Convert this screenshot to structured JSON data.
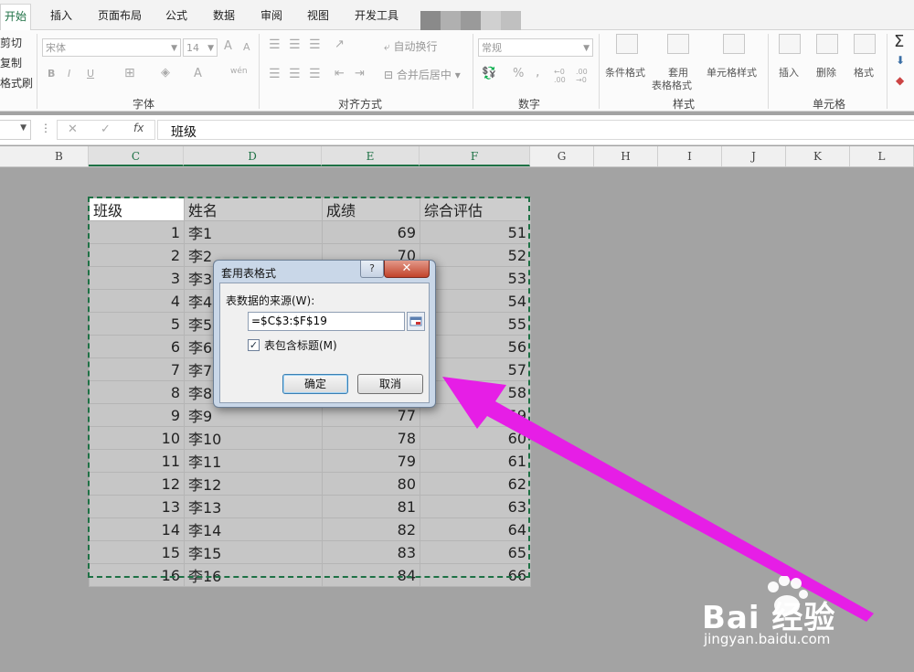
{
  "ribbon": {
    "tabs": [
      "开始",
      "插入",
      "页面布局",
      "公式",
      "数据",
      "审阅",
      "视图",
      "开发工具"
    ],
    "active_tab": "开始",
    "clipboard": {
      "cut": "剪切",
      "copy": "复制",
      "format_painter": "格式刷"
    },
    "font": {
      "name": "宋体",
      "size": "14",
      "bold": "B",
      "italic": "I",
      "underline": "U",
      "grow": "A",
      "shrink": "A",
      "color": "A",
      "phonetic": "wén",
      "group": "字体"
    },
    "alignment": {
      "wrap": "自动换行",
      "merge": "合并后居中",
      "group": "对齐方式"
    },
    "number": {
      "format": "常规",
      "percent": "%",
      "comma": ",",
      "inc_dec": "←0 .00",
      "dec_dec": ".00 →0",
      "group": "数字"
    },
    "styles": {
      "conditional": "条件格式",
      "apply_table": "套用",
      "apply_table_2": "表格格式",
      "cell_styles": "单元格样式",
      "group": "样式"
    },
    "cells": {
      "insert": "插入",
      "delete": "删除",
      "format": "格式",
      "group": "单元格"
    },
    "editing": {
      "sum": "Σ"
    }
  },
  "formula_bar": {
    "fx": "fx",
    "cancel": "✕",
    "enter": "✓",
    "value": "班级"
  },
  "columns": [
    "B",
    "C",
    "D",
    "E",
    "F",
    "G",
    "H",
    "I",
    "J",
    "K",
    "L"
  ],
  "selected_columns": [
    "C",
    "D",
    "E",
    "F"
  ],
  "sheet": {
    "headers": [
      "班级",
      "姓名",
      "成绩",
      "综合评估"
    ],
    "rows": [
      [
        "1",
        "李1",
        "69",
        "51"
      ],
      [
        "2",
        "李2",
        "70",
        "52"
      ],
      [
        "3",
        "李3",
        "",
        "53"
      ],
      [
        "4",
        "李4",
        "",
        "54"
      ],
      [
        "5",
        "李5",
        "",
        "55"
      ],
      [
        "6",
        "李6",
        "",
        "56"
      ],
      [
        "7",
        "李7",
        "",
        "57"
      ],
      [
        "8",
        "李8",
        "",
        "58"
      ],
      [
        "9",
        "李9",
        "77",
        "59"
      ],
      [
        "10",
        "李10",
        "78",
        "60"
      ],
      [
        "11",
        "李11",
        "79",
        "61"
      ],
      [
        "12",
        "李12",
        "80",
        "62"
      ],
      [
        "13",
        "李13",
        "81",
        "63"
      ],
      [
        "14",
        "李14",
        "82",
        "64"
      ],
      [
        "15",
        "李15",
        "83",
        "65"
      ],
      [
        "16",
        "李16",
        "84",
        "66"
      ]
    ]
  },
  "dialog": {
    "title": "套用表格式",
    "help": "?",
    "close": "✕",
    "source_label": "表数据的来源(W):",
    "source_value": "=$C$3:$F$19",
    "has_headers_label": "表包含标题(M)",
    "has_headers_checked": "✓",
    "ok": "确定",
    "cancel": "取消"
  },
  "arrow_color": "#e61ee6",
  "accent": "#1e7145",
  "watermark": {
    "brand": "Bai  经验",
    "url": "jingyan.baidu.com"
  }
}
